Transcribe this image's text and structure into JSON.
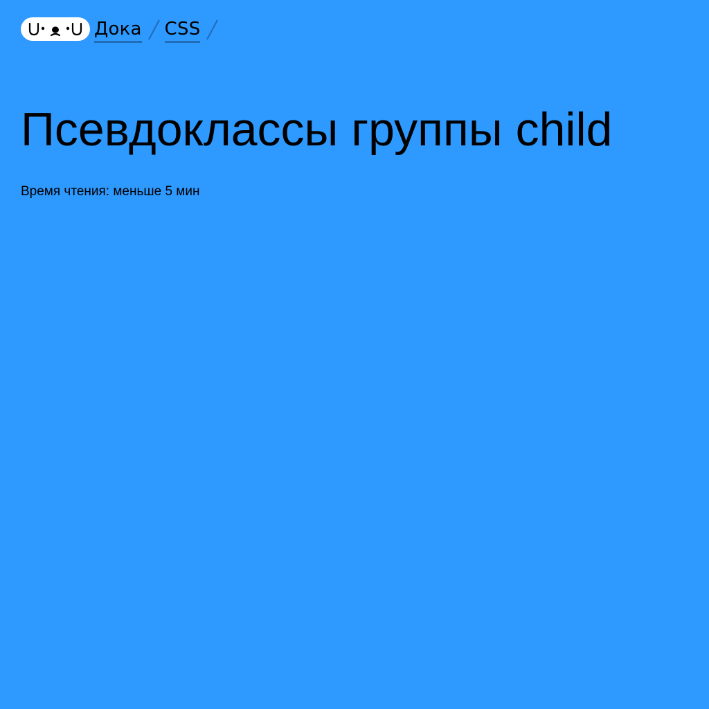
{
  "site": {
    "logo_text": "U•ᴥ•U",
    "logo_icon": "doka-dog-face-logo"
  },
  "breadcrumbs": [
    {
      "label": "Дока"
    },
    {
      "label": "CSS"
    }
  ],
  "article": {
    "title": "Псевдоклассы группы child",
    "reading_time": "Время чтения: меньше 5 мин"
  },
  "colors": {
    "background": "#2e99ff",
    "text": "#000000",
    "link_underline": "#1f6cb8",
    "separator": "#1f6cb8",
    "logo_bg": "#ffffff"
  }
}
